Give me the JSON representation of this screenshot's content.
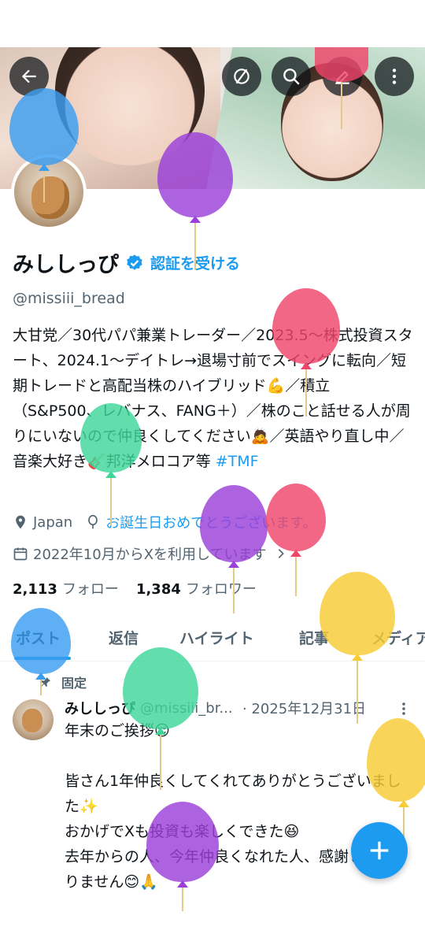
{
  "header": {
    "back_icon": "arrow-left-icon",
    "actions": [
      "no-notification-icon",
      "search-icon",
      "edit-icon",
      "more-vertical-icon"
    ]
  },
  "profile": {
    "display_name": "みししっぴ",
    "verify_label": "認証を受ける",
    "handle": "@missiii_bread",
    "bio_main": "大甘党／30代パパ兼業トレーダー／2023.5〜株式投資スタート、2024.1〜デイトレ→退場寸前でスイングに転向／短期トレードと高配当株のハイブリッド💪／積立（S&P500、レバナス、FANG＋）／株のこと話せる人が周りにいないので仲良くしてください🙇／英語やり直し中／音楽大好き🎸邦洋メロコア等 ",
    "bio_hashtag": "#TMF",
    "location": "Japan",
    "birthday_text": "お誕生日おめでとうございます。",
    "joined": "2022年10月からXを利用しています",
    "following_count": "2,113",
    "following_label": "フォロー",
    "followers_count": "1,384",
    "followers_label": "フォロワー"
  },
  "tabs": [
    "ポスト",
    "返信",
    "ハイライト",
    "記事",
    "メディア"
  ],
  "pinned_post": {
    "pinned_label": "固定",
    "name": "みししっぴ",
    "handle": "@missiii_br...",
    "date": "· 2025年12月31日",
    "text": "年末のご挨拶😌\n\n皆さん1年仲良くしてくれてありがとうございました✨\nおかげでXも投資も楽しくできた😆\n去年からの人、今年仲良くなれた人、感謝しかありません😊🙏"
  },
  "fab": {
    "icon": "plus-icon"
  },
  "colors": {
    "accent": "#1d9bf0",
    "text": "#0f1419",
    "secondary_text": "#536471",
    "balloon_blue": "#3a9ef0",
    "balloon_purple": "#9b3fd8",
    "balloon_pink": "#f0456b",
    "balloon_green": "#3fd69a",
    "balloon_yellow": "#f7cc35"
  }
}
